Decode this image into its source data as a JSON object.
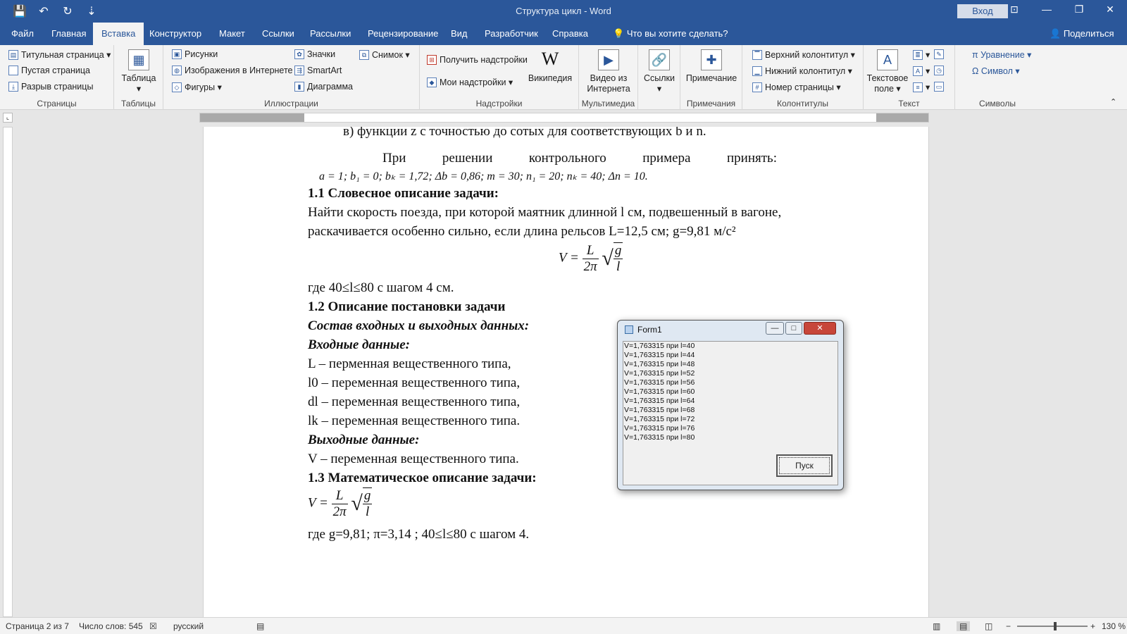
{
  "titlebar": {
    "title": "Структура цикл - Word",
    "signin": "Вход",
    "qat": [
      "💾",
      "↶",
      "↻",
      "⇣"
    ],
    "winctl": [
      "⊡",
      "—",
      "❐",
      "✕"
    ]
  },
  "tabs": {
    "items": [
      {
        "label": "Файл"
      },
      {
        "label": "Главная"
      },
      {
        "label": "Вставка"
      },
      {
        "label": "Конструктор"
      },
      {
        "label": "Макет"
      },
      {
        "label": "Ссылки"
      },
      {
        "label": "Рассылки"
      },
      {
        "label": "Рецензирование"
      },
      {
        "label": "Вид"
      },
      {
        "label": "Разработчик"
      },
      {
        "label": "Справка"
      },
      {
        "label": "Что вы хотите сделать?"
      }
    ],
    "active": "Вставка",
    "share": "Поделиться"
  },
  "ribbon": {
    "pages": {
      "label": "Страницы",
      "items": [
        "Титульная страница ▾",
        "Пустая страница",
        "Разрыв страницы"
      ]
    },
    "tables": {
      "label": "Таблицы",
      "button": "Таблица"
    },
    "illustrations": {
      "label": "Иллюстрации",
      "items": [
        "Рисунки",
        "Изображения в Интернете",
        "Фигуры ▾",
        "Значки",
        "SmartArt",
        "Диаграмма",
        "Снимок ▾"
      ]
    },
    "addins": {
      "label": "Надстройки",
      "items": [
        "Получить надстройки",
        "Мои надстройки ▾"
      ],
      "wiki": "Википедия"
    },
    "media": {
      "label": "Мультимедиа",
      "button": "Видео из Интернета"
    },
    "links": {
      "button": "Ссылки"
    },
    "comments": {
      "label": "Примечания",
      "button": "Примечание"
    },
    "headerfooter": {
      "label": "Колонтитулы",
      "items": [
        "Верхний колонтитул ▾",
        "Нижний колонтитул ▾",
        "Номер страницы ▾"
      ]
    },
    "text": {
      "label": "Текст",
      "button": "Текстовое поле ▾"
    },
    "symbols": {
      "label": "Символы",
      "items": [
        "π Уравнение ▾",
        "Ω Символ ▾"
      ]
    }
  },
  "document": {
    "line_cut": "в) функции  z с точностью до сотых для соответствующих  b и  n.",
    "accept_words": [
      "При",
      "решении",
      "контрольного",
      "примера",
      "принять:"
    ],
    "params": "a = 1; b₁ = 0; bₖ = 1,72; Δb = 0,86; m = 30; n₁ = 20; nₖ = 40; Δn = 10.",
    "h1": "1.1 Словесное описание задачи:",
    "p1": "Найти скорость поезда, при которой маятник длинной l см, подвешенный в вагоне,",
    "p2": "раскачивается особенно сильно, если длина рельсов L=12,5 см; g=9,81 м/с²",
    "formula": {
      "lhs": "V = ",
      "num": "L",
      "den": "2π",
      "rad_num": "g",
      "rad_den": "l"
    },
    "p3": "где 40≤l≤80 с шагом 4 см.",
    "h2": "1.2  Описание постановки задачи",
    "sub1": "Состав входных и выходных данных:",
    "sub2": "Входные данные:",
    "in1": "L – перменная вещественного типа,",
    "in2": "l0 – переменная вещественного типа,",
    "in3": "dl – переменная вещественного типа,",
    "in4": "lk – переменная вещественного типа.",
    "sub3": "Выходные данные:",
    "out1": "V – переменная вещественного типа.",
    "h3": "1.3 Математическое описание задачи:",
    "p4": "где g=9,81; π=3,14 ; 40≤l≤80 с шагом 4."
  },
  "form1": {
    "title": "Form1",
    "lines": [
      "V=1,763315 при l=40",
      "V=1,763315 при l=44",
      "V=1,763315 при l=48",
      "V=1,763315 при l=52",
      "V=1,763315 при l=56",
      "V=1,763315 при l=60",
      "V=1,763315 при l=64",
      "V=1,763315 при l=68",
      "V=1,763315 при l=72",
      "V=1,763315 при l=76",
      "V=1,763315 при l=80"
    ],
    "button": "Пуск",
    "controls": [
      "—",
      "□",
      "✕"
    ]
  },
  "statusbar": {
    "page": "Страница 2 из 7",
    "words": "Число слов: 545",
    "lang": "русский",
    "zoom": "130 %",
    "zoom_percent": 130
  }
}
